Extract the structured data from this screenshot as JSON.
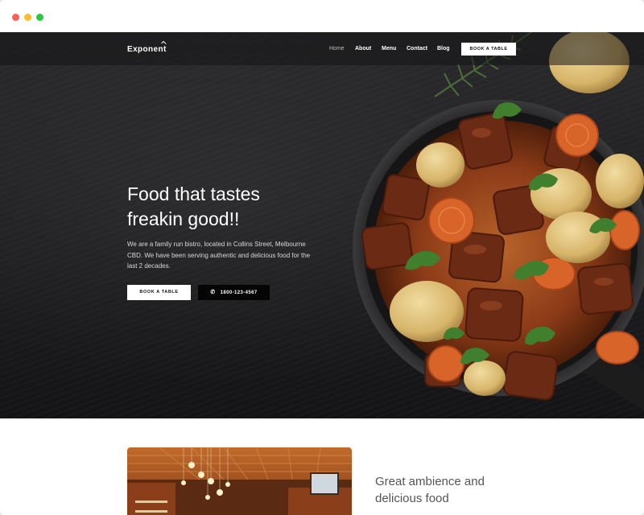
{
  "window": {
    "controls": [
      {
        "name": "close",
        "color": "#ff5f57"
      },
      {
        "name": "minimize",
        "color": "#febc2e"
      },
      {
        "name": "maximize",
        "color": "#28c840"
      }
    ]
  },
  "nav": {
    "logo": "Exponent",
    "links": [
      "Home",
      "About",
      "Menu",
      "Contact",
      "Blog"
    ],
    "active": "Home",
    "cta": "BOOK A TABLE"
  },
  "hero": {
    "headline": [
      "Food that tastes",
      "freakin good!!"
    ],
    "intro": "We are a family run bistro, located in Collins Street, Melbourne CBD. We have been serving authentic and delicious food for the last 2 decades.",
    "primary_button": "BOOK A TABLE",
    "phone_button": "1800-123-4567",
    "phone_icon": "phone-icon"
  },
  "feature": {
    "title": [
      "Great ambience and",
      "delicious food"
    ]
  },
  "colors": {
    "hero_background": "#1f1f21",
    "accent_white": "#ffffff",
    "phone_button": "#050505",
    "feature_text": "#555555"
  }
}
